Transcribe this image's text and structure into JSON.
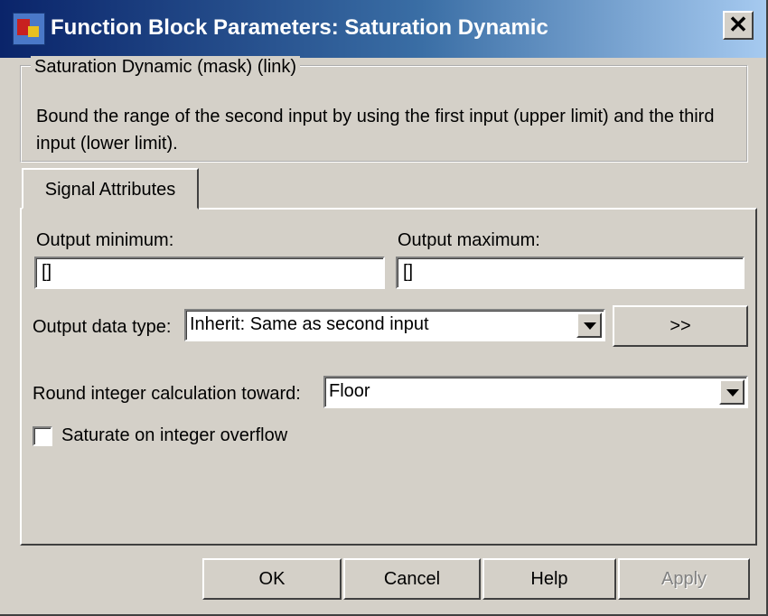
{
  "window": {
    "title": "Function Block Parameters: Saturation Dynamic",
    "close_glyph": "✕"
  },
  "group": {
    "legend": "Saturation Dynamic (mask) (link)",
    "description": "Bound the range of the second input by using the first input (upper limit) and the third input (lower limit)."
  },
  "tabs": [
    {
      "label": "Signal Attributes",
      "selected": true
    }
  ],
  "output_minimum": {
    "label": "Output minimum:",
    "value": "[]"
  },
  "output_maximum": {
    "label": "Output maximum:",
    "value": "[]"
  },
  "output_data_type": {
    "label": "Output data type:",
    "value": "Inherit: Same as second input",
    "assistant_label": ">>"
  },
  "rounding": {
    "label": "Round integer calculation toward:",
    "value": "Floor"
  },
  "saturate": {
    "label": "Saturate on integer overflow",
    "checked": false
  },
  "buttons": {
    "ok": "OK",
    "cancel": "Cancel",
    "help": "Help",
    "apply": "Apply"
  },
  "icons": {
    "window": "simulink-block-icon",
    "close": "close-icon",
    "dropdown": "chevron-down-icon"
  },
  "colors": {
    "face": "#d4d0c8",
    "title_start": "#0a246a",
    "title_end": "#a6caf0"
  }
}
